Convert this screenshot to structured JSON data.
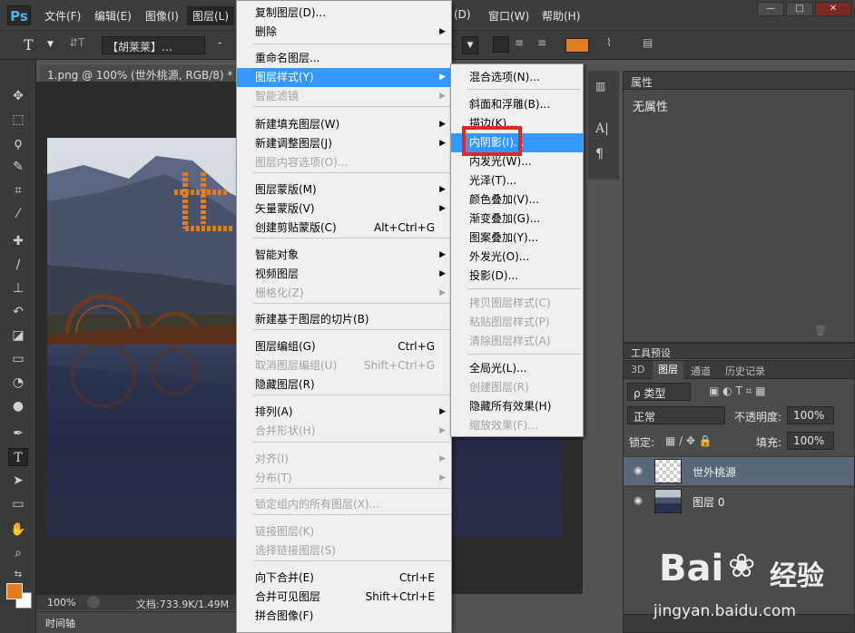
{
  "app": {
    "logo": "Ps"
  },
  "menubar": {
    "items": [
      "文件(F)",
      "编辑(E)",
      "图像(I)",
      "图层(L)",
      "(D)",
      "窗口(W)",
      "帮助(H)"
    ],
    "window_controls": [
      "—",
      "□",
      "✕"
    ]
  },
  "options": {
    "tool_glyph": "T",
    "orient_glyph": "⇵T",
    "font_name": "【胡莱莱】…",
    "size_glyph": "-"
  },
  "document": {
    "tab_title": "1.png @ 100% (世外桃源, RGB/8) *",
    "zoom": "100%",
    "doc_size": "文档:733.9K/1.49M",
    "timeline_label": "时间轴"
  },
  "menus": {
    "layer": {
      "items": [
        {
          "label": "复制图层(D)...",
          "shortcut": "",
          "arrow": false,
          "disabled": false
        },
        {
          "label": "删除",
          "shortcut": "",
          "arrow": true,
          "disabled": false
        },
        {
          "label": "重命名图层...",
          "shortcut": "",
          "arrow": false,
          "disabled": false
        },
        {
          "label": "图层样式(Y)",
          "shortcut": "",
          "arrow": true,
          "disabled": false,
          "highlight": true
        },
        {
          "label": "智能滤镜",
          "shortcut": "",
          "arrow": true,
          "disabled": true
        },
        {
          "label": "新建填充图层(W)",
          "shortcut": "",
          "arrow": true,
          "disabled": false
        },
        {
          "label": "新建调整图层(J)",
          "shortcut": "",
          "arrow": true,
          "disabled": false
        },
        {
          "label": "图层内容选项(O)...",
          "shortcut": "",
          "arrow": false,
          "disabled": true
        },
        {
          "label": "图层蒙版(M)",
          "shortcut": "",
          "arrow": true,
          "disabled": false
        },
        {
          "label": "矢量蒙版(V)",
          "shortcut": "",
          "arrow": true,
          "disabled": false
        },
        {
          "label": "创建剪贴蒙版(C)",
          "shortcut": "Alt+Ctrl+G",
          "arrow": false,
          "disabled": false
        },
        {
          "label": "智能对象",
          "shortcut": "",
          "arrow": true,
          "disabled": false
        },
        {
          "label": "视频图层",
          "shortcut": "",
          "arrow": true,
          "disabled": false
        },
        {
          "label": "栅格化(Z)",
          "shortcut": "",
          "arrow": true,
          "disabled": true
        },
        {
          "label": "新建基于图层的切片(B)",
          "shortcut": "",
          "arrow": false,
          "disabled": false
        },
        {
          "label": "图层编组(G)",
          "shortcut": "Ctrl+G",
          "arrow": false,
          "disabled": false
        },
        {
          "label": "取消图层编组(U)",
          "shortcut": "Shift+Ctrl+G",
          "arrow": false,
          "disabled": true
        },
        {
          "label": "隐藏图层(R)",
          "shortcut": "",
          "arrow": false,
          "disabled": false
        },
        {
          "label": "排列(A)",
          "shortcut": "",
          "arrow": true,
          "disabled": false
        },
        {
          "label": "合并形状(H)",
          "shortcut": "",
          "arrow": true,
          "disabled": true
        },
        {
          "label": "对齐(I)",
          "shortcut": "",
          "arrow": true,
          "disabled": true
        },
        {
          "label": "分布(T)",
          "shortcut": "",
          "arrow": true,
          "disabled": true
        },
        {
          "label": "锁定组内的所有图层(X)...",
          "shortcut": "",
          "arrow": false,
          "disabled": true
        },
        {
          "label": "链接图层(K)",
          "shortcut": "",
          "arrow": false,
          "disabled": true
        },
        {
          "label": "选择链接图层(S)",
          "shortcut": "",
          "arrow": false,
          "disabled": true
        },
        {
          "label": "向下合并(E)",
          "shortcut": "Ctrl+E",
          "arrow": false,
          "disabled": false
        },
        {
          "label": "合并可见图层",
          "shortcut": "Shift+Ctrl+E",
          "arrow": false,
          "disabled": false
        },
        {
          "label": "拼合图像(F)",
          "shortcut": "",
          "arrow": false,
          "disabled": false
        }
      ]
    },
    "style": {
      "items": [
        {
          "label": "混合选项(N)...",
          "disabled": false
        },
        {
          "label": "斜面和浮雕(B)...",
          "disabled": false
        },
        {
          "label": "描边(K)...",
          "disabled": false
        },
        {
          "label": "内阴影(I)...",
          "disabled": false,
          "highlight": true
        },
        {
          "label": "内发光(W)...",
          "disabled": false
        },
        {
          "label": "光泽(T)...",
          "disabled": false
        },
        {
          "label": "颜色叠加(V)...",
          "disabled": false
        },
        {
          "label": "渐变叠加(G)...",
          "disabled": false
        },
        {
          "label": "图案叠加(Y)...",
          "disabled": false
        },
        {
          "label": "外发光(O)...",
          "disabled": false
        },
        {
          "label": "投影(D)...",
          "disabled": false
        },
        {
          "label": "拷贝图层样式(C)",
          "disabled": true
        },
        {
          "label": "粘贴图层样式(P)",
          "disabled": true
        },
        {
          "label": "清除图层样式(A)",
          "disabled": true
        },
        {
          "label": "全局光(L)...",
          "disabled": false
        },
        {
          "label": "创建图层(R)",
          "disabled": true
        },
        {
          "label": "隐藏所有效果(H)",
          "disabled": false
        },
        {
          "label": "缩放效果(F)...",
          "disabled": true
        }
      ]
    }
  },
  "properties": {
    "title": "属性",
    "value": "无属性"
  },
  "tool_presets": {
    "title": "工具预设"
  },
  "layers": {
    "tabs": [
      "3D",
      "图层",
      "通道",
      "历史记录"
    ],
    "filter": "ρ 类型",
    "blend_mode": "正常",
    "opacity_label": "不透明度:",
    "opacity": "100%",
    "lock_label": "锁定:",
    "fill_label": "填充:",
    "fill": "100%",
    "rows": [
      {
        "name": "世外桃源",
        "selected": true
      },
      {
        "name": "图层 0",
        "selected": false
      }
    ]
  },
  "watermark": {
    "text": "Bai",
    "sub": "经验",
    "url": "jingyan.baidu.com"
  },
  "colors": {
    "accent": "#3399ff",
    "foreground": "#e07c23",
    "red_box": "#e8242a"
  }
}
